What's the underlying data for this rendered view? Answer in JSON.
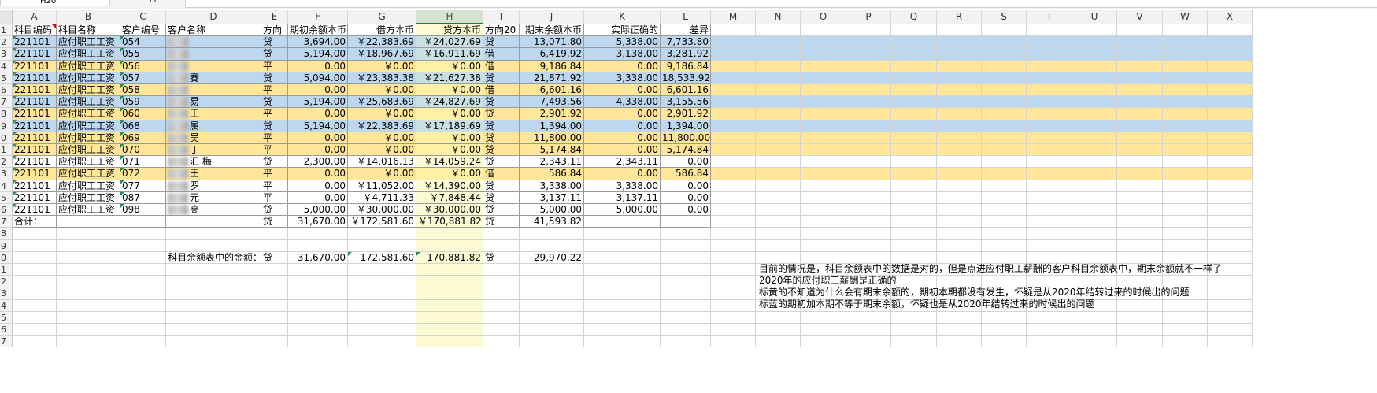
{
  "formula_bar": {
    "name_box": "H20",
    "fx_label": "fx",
    "content": ""
  },
  "columns": [
    {
      "letter": "A",
      "w": 56
    },
    {
      "letter": "B",
      "w": 81
    },
    {
      "letter": "C",
      "w": 58
    },
    {
      "letter": "D",
      "w": 121
    },
    {
      "letter": "E",
      "w": 34
    },
    {
      "letter": "F",
      "w": 76
    },
    {
      "letter": "G",
      "w": 87
    },
    {
      "letter": "H",
      "w": 85
    },
    {
      "letter": "I",
      "w": 46
    },
    {
      "letter": "J",
      "w": 82
    },
    {
      "letter": "K",
      "w": 97
    },
    {
      "letter": "L",
      "w": 64
    },
    {
      "letter": "M",
      "w": 57
    },
    {
      "letter": "N",
      "w": 57
    },
    {
      "letter": "O",
      "w": 58
    },
    {
      "letter": "P",
      "w": 57
    },
    {
      "letter": "Q",
      "w": 58
    },
    {
      "letter": "R",
      "w": 57
    },
    {
      "letter": "S",
      "w": 57
    },
    {
      "letter": "T",
      "w": 58
    },
    {
      "letter": "U",
      "w": 57
    },
    {
      "letter": "V",
      "w": 58
    },
    {
      "letter": "W",
      "w": 57
    },
    {
      "letter": "X",
      "w": 57
    }
  ],
  "selected_column": "H",
  "colors": {
    "blue": "#bdd7ee",
    "yellow": "#ffe699",
    "selected_col": "#fdfbd3",
    "selected_col_blue": "#c9e0e4",
    "selected_col_yellow": "#fff0a8"
  },
  "header_row": {
    "num": "1",
    "cells": [
      "科目编码",
      "科目名称",
      "客户编号",
      "客户名称",
      "方向",
      "期初余额本币",
      "借方本币",
      "贷方本币",
      "方向20",
      "期末余额本币",
      "实际正确的",
      "差异"
    ]
  },
  "rows": [
    {
      "num": "2",
      "color": "blue",
      "cells": [
        "221101",
        "应付职工工资",
        "054",
        "",
        "贷",
        "3,694.00",
        "￥22,383.69",
        "￥24,027.69",
        "贷",
        "13,071.80",
        "5,338.00",
        "7,733.80"
      ]
    },
    {
      "num": "3",
      "color": "blue",
      "cells": [
        "221101",
        "应付职工工资",
        "055",
        "",
        "贷",
        "5,194.00",
        "￥18,967.69",
        "￥16,911.69",
        "借",
        "6,419.92",
        "3,138.00",
        "3,281.92"
      ]
    },
    {
      "num": "4",
      "color": "yellow",
      "cells": [
        "221101",
        "应付职工工资",
        "056",
        "",
        "平",
        "0.00",
        "￥0.00",
        "￥0.00",
        "借",
        "9,186.84",
        "0.00",
        "9,186.84"
      ]
    },
    {
      "num": "5",
      "color": "blue",
      "cells": [
        "221101",
        "应付职工工资",
        "057",
        "賽",
        "贷",
        "5,094.00",
        "￥23,383.38",
        "￥21,627.38",
        "贷",
        "21,871.92",
        "3,338.00",
        "18,533.92"
      ]
    },
    {
      "num": "6",
      "color": "yellow",
      "cells": [
        "221101",
        "应付职工工资",
        "058",
        "",
        "平",
        "0.00",
        "￥0.00",
        "￥0.00",
        "借",
        "6,601.16",
        "0.00",
        "6,601.16"
      ]
    },
    {
      "num": "7",
      "color": "blue",
      "cells": [
        "221101",
        "应付职工工资",
        "059",
        "易",
        "贷",
        "5,194.00",
        "￥25,683.69",
        "￥24,827.69",
        "贷",
        "7,493.56",
        "4,338.00",
        "3,155.56"
      ]
    },
    {
      "num": "8",
      "color": "yellow",
      "cells": [
        "221101",
        "应付职工工资",
        "060",
        "王",
        "平",
        "0.00",
        "￥0.00",
        "￥0.00",
        "贷",
        "2,901.92",
        "0.00",
        "2,901.92"
      ]
    },
    {
      "num": "9",
      "color": "blue",
      "cells": [
        "221101",
        "应付职工工资",
        "068",
        "属",
        "贷",
        "5,194.00",
        "￥22,383.69",
        "￥17,189.69",
        "贷",
        "1,394.00",
        "0.00",
        "1,394.00"
      ]
    },
    {
      "num": "0",
      "color": "yellow",
      "cells": [
        "221101",
        "应付职工工资",
        "069",
        "吴",
        "平",
        "0.00",
        "￥0.00",
        "￥0.00",
        "贷",
        "11,800.00",
        "0.00",
        "11,800.00"
      ]
    },
    {
      "num": "1",
      "color": "yellow",
      "cells": [
        "221101",
        "应付职工工资",
        "070",
        "丁",
        "平",
        "0.00",
        "￥0.00",
        "￥0.00",
        "贷",
        "5,174.84",
        "0.00",
        "5,174.84"
      ]
    },
    {
      "num": "2",
      "color": "none",
      "cells": [
        "221101",
        "应付职工工资",
        "071",
        "汇 梅",
        "贷",
        "2,300.00",
        "￥14,016.13",
        "￥14,059.24",
        "贷",
        "2,343.11",
        "2,343.11",
        "0.00"
      ]
    },
    {
      "num": "3",
      "color": "yellow",
      "cells": [
        "221101",
        "应付职工工资",
        "072",
        "王",
        "平",
        "0.00",
        "￥0.00",
        "￥0.00",
        "借",
        "586.84",
        "0.00",
        "586.84"
      ]
    },
    {
      "num": "4",
      "color": "none",
      "cells": [
        "221101",
        "应付职工工资",
        "077",
        "罗",
        "平",
        "0.00",
        "￥11,052.00",
        "￥14,390.00",
        "贷",
        "3,338.00",
        "3,338.00",
        "0.00"
      ]
    },
    {
      "num": "5",
      "color": "none",
      "cells": [
        "221101",
        "应付职工工资",
        "087",
        "元",
        "平",
        "0.00",
        "￥4,711.33",
        "￥7,848.44",
        "贷",
        "3,137.11",
        "3,137.11",
        "0.00"
      ]
    },
    {
      "num": "6",
      "color": "none",
      "cells": [
        "221101",
        "应付职工工资",
        "098",
        "高",
        "贷",
        "5,000.00",
        "￥30,000.00",
        "￥30,000.00",
        "贷",
        "5,000.00",
        "5,000.00",
        "0.00"
      ]
    },
    {
      "num": "7",
      "color": "none",
      "cells": [
        "合计：",
        "",
        "",
        "",
        "贷",
        "31,670.00",
        "￥172,581.60",
        "￥170,881.82",
        "贷",
        "41,593.82",
        "",
        ""
      ]
    }
  ],
  "blank_rows_1": [
    "8",
    "9"
  ],
  "balance_row": {
    "num": "0",
    "label": "科目余额表中的金额：",
    "direction": "贷",
    "opening": "31,670.00",
    "debit": "172,581.60",
    "credit": "170,881.82",
    "direction2": "贷",
    "closing": "29,970.22"
  },
  "tail_rows": [
    "1",
    "2",
    "3",
    "4",
    "5",
    "6",
    "7"
  ],
  "notes": [
    "目前的情况是，科目余额表中的数据是对的，但是点进应付职工薪酬的客户科目余额表中，期末余额就不一样了",
    "2020年的应付职工薪酬是正确的",
    "标黄的不知道为什么会有期末余额的，期初本期都没有发生，怀疑是从2020年结转过来的时候出的问题",
    "标蓝的期初加本期不等于期末余额，怀疑也是从2020年结转过来的时候出的问题"
  ]
}
